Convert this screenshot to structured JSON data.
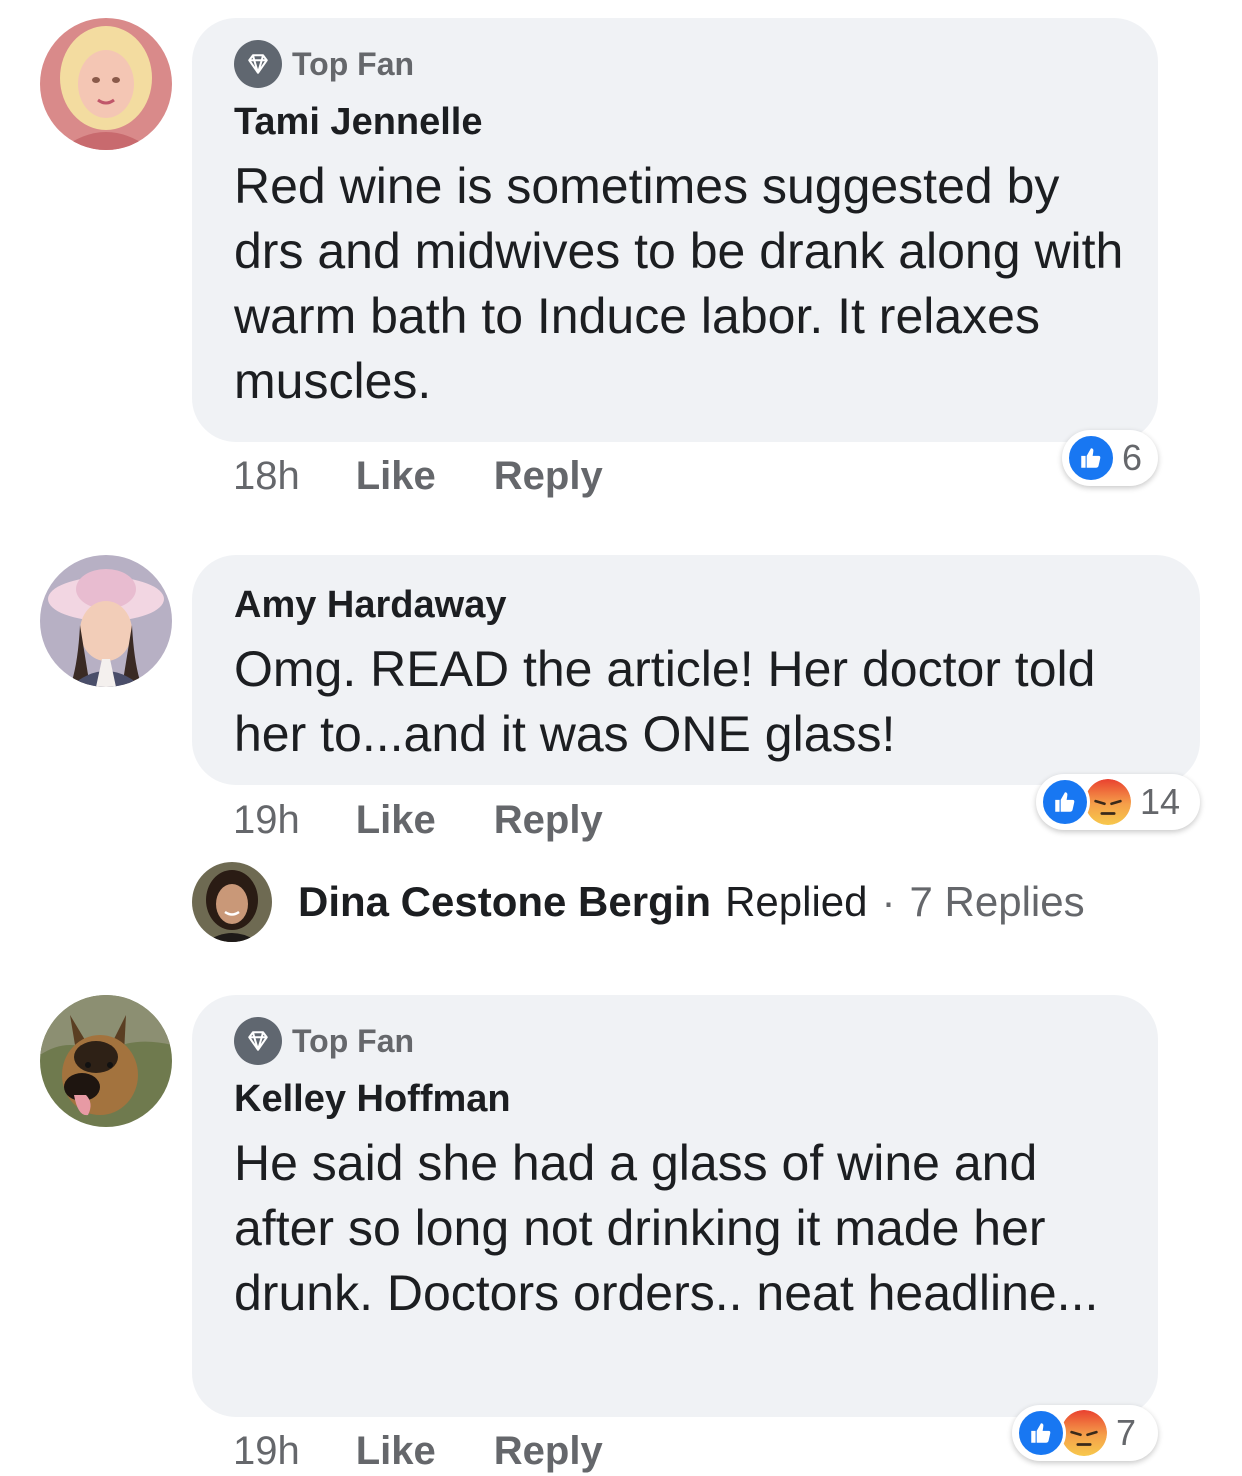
{
  "colors": {
    "bubble": "#f0f2f5",
    "like_blue": "#1877f2",
    "meta_gray": "#65676b",
    "text": "#1c1e21"
  },
  "comments": [
    {
      "badge": "Top Fan",
      "author": "Tami Jennelle",
      "text": "Red wine is sometimes suggested by drs and midwives to be drank along with warm bath to Induce labor. It relaxes muscles.",
      "time": "18h",
      "like_label": "Like",
      "reply_label": "Reply",
      "reaction_icons": [
        "like-icon"
      ],
      "reaction_count": "6"
    },
    {
      "author": "Amy Hardaway",
      "text": "Omg. READ the article! Her doctor told her to...and it was ONE glass!",
      "time": "19h",
      "like_label": "Like",
      "reply_label": "Reply",
      "reaction_icons": [
        "like-icon",
        "angry-icon"
      ],
      "reaction_count": "14",
      "replies": {
        "who": "Dina Cestone Bergin",
        "action": "Replied",
        "separator": "·",
        "count": "7 Replies"
      }
    },
    {
      "badge": "Top Fan",
      "author": "Kelley Hoffman",
      "text": "He said she had a glass of wine and after so long not drinking it made her drunk. Doctors orders.. neat headline...",
      "time": "19h",
      "like_label": "Like",
      "reply_label": "Reply",
      "reaction_icons": [
        "like-icon",
        "angry-icon"
      ],
      "reaction_count": "7"
    }
  ]
}
